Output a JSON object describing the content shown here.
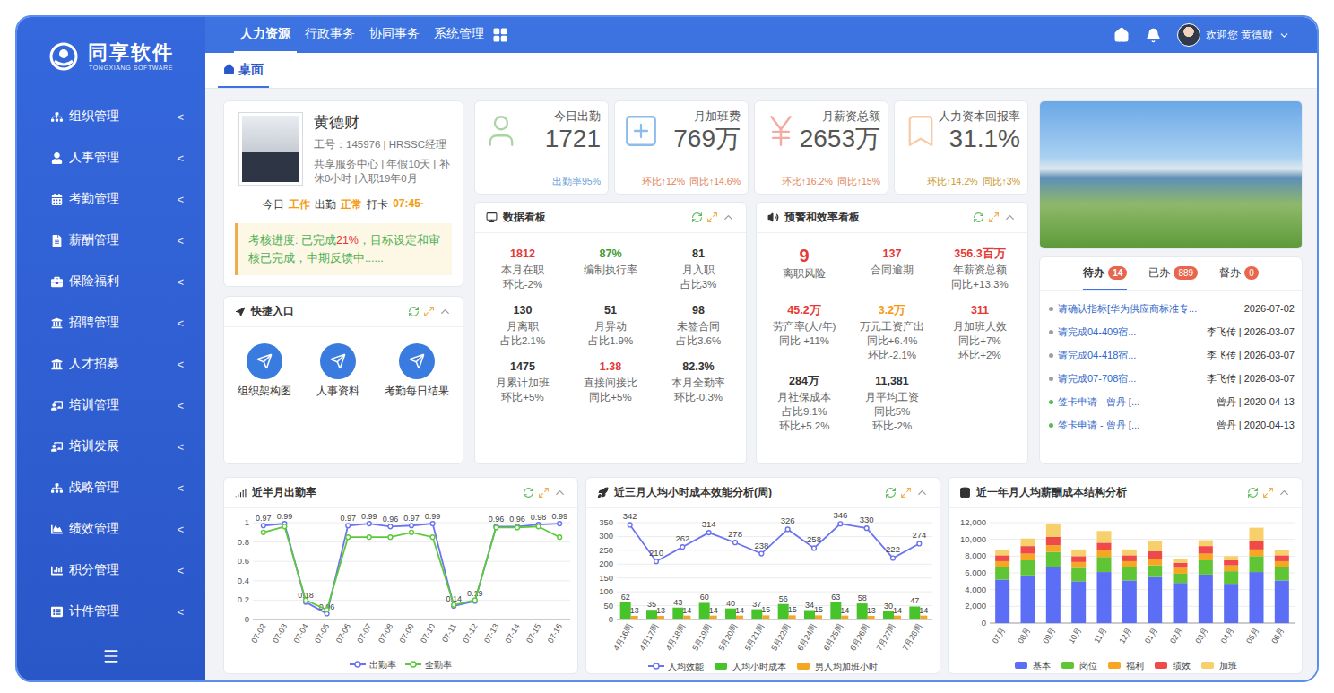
{
  "logo": {
    "name": "同享软件",
    "subtitle": "TONGXIANG SOFTWARE"
  },
  "top_nav": [
    {
      "label": "人力资源",
      "selected": true
    },
    {
      "label": "行政事务",
      "selected": false
    },
    {
      "label": "协同事务",
      "selected": false
    },
    {
      "label": "系统管理",
      "selected": false
    }
  ],
  "user": {
    "greeting": "欢迎您 黄德财"
  },
  "sidebar": {
    "chevron": "<",
    "items": [
      "组织管理",
      "人事管理",
      "考勤管理",
      "薪酬管理",
      "保险福利",
      "招聘管理",
      "人才招募",
      "培训管理",
      "培训发展",
      "战略管理",
      "绩效管理",
      "积分管理",
      "计件管理"
    ]
  },
  "tabs": [
    {
      "label": "桌面",
      "selected": true
    }
  ],
  "profile": {
    "name": "黄德财",
    "id_line": "工号：145976 | HRSSC经理",
    "info": "共享服务中心 | 年假10天 | 补休0小时 |入职19年0月",
    "today": [
      {
        "text": "今日",
        "highlight": false
      },
      {
        "text": "工作",
        "highlight": true
      },
      {
        "text": "出勤",
        "highlight": false
      },
      {
        "text": "正常",
        "highlight": true
      },
      {
        "text": "打卡",
        "highlight": false
      },
      {
        "text": "07:45-",
        "highlight": true
      }
    ]
  },
  "assessment": {
    "parts": [
      {
        "text": "考核进度: 已完成",
        "color": "#4caf50"
      },
      {
        "text": "21%",
        "color": "#e53935"
      },
      {
        "text": "，目标设定和审核已完成，中期反馈中......",
        "color": "#4caf50"
      }
    ]
  },
  "quick_entry": {
    "title": "快捷入口",
    "items": [
      "组织架构图",
      "人事资料",
      "考勤每日结果"
    ]
  },
  "kpis": [
    {
      "title": "今日出勤",
      "value": "1721",
      "notes": [
        "出勤率95%"
      ],
      "color": "#a8d5a2",
      "note_color": "#6fa1d6"
    },
    {
      "title": "月加班费",
      "value": "769万",
      "notes": [
        "环比↑12%",
        "同比↑14.6%"
      ],
      "color": "#8cbcea",
      "note_color": "#e0845a"
    },
    {
      "title": "月薪资总额",
      "value": "2653万",
      "notes": [
        "环比↑16.2%",
        "同比↑15%"
      ],
      "color": "#f4aba1",
      "note_color": "#e0845a"
    },
    {
      "title": "人力资本回报率",
      "value": "31.1%",
      "notes": [
        "环比↑14.2%",
        "同比↑3%"
      ],
      "color": "#f8cba6",
      "note_color": "#c9962c"
    }
  ],
  "data_board": {
    "title": "数据看板",
    "cells": [
      {
        "value": "1812",
        "label": "本月在职",
        "notes": [
          "环比-2%"
        ],
        "color": "#e53935",
        "kind": "normal"
      },
      {
        "value": "87%",
        "label": "编制执行率",
        "notes": [],
        "color": "#3c9a3c",
        "kind": "normal"
      },
      {
        "value": "81",
        "label": "月入职",
        "notes": [
          "占比3%"
        ],
        "color": "#333333",
        "kind": "normal"
      },
      {
        "value": "130",
        "label": "月离职",
        "notes": [
          "占比2.1%"
        ],
        "color": "#333333",
        "kind": "normal"
      },
      {
        "value": "51",
        "label": "月异动",
        "notes": [
          "占比1.9%"
        ],
        "color": "#333333",
        "kind": "normal"
      },
      {
        "value": "98",
        "label": "未签合同",
        "notes": [
          "占比3.6%"
        ],
        "color": "#333333",
        "kind": "normal"
      },
      {
        "value": "1475",
        "label": "月累计加班",
        "notes": [
          "环比+5%"
        ],
        "color": "#333333",
        "kind": "normal"
      },
      {
        "value": "1.38",
        "label": "直接间接比",
        "notes": [
          "同比+5%"
        ],
        "color": "#e53935",
        "kind": "normal"
      },
      {
        "value": "82.3%",
        "label": "本月全勤率",
        "notes": [
          "环比-0.3%"
        ],
        "color": "#333333",
        "kind": "normal"
      }
    ]
  },
  "warning_board": {
    "title": "预警和效率看板",
    "cells": [
      {
        "value": "9",
        "label": "离职风险",
        "notes": [],
        "color": "#e53935",
        "kind": "big"
      },
      {
        "value": "137",
        "label": "合同逾期",
        "notes": [],
        "color": "#e53935",
        "kind": "normal"
      },
      {
        "value": "356.3百万",
        "label": "年薪资总额",
        "notes": [
          "同比+13.3%"
        ],
        "color": "#e53935",
        "kind": "normal"
      },
      {
        "value": "45.2万",
        "label": "劳产率(人/年)",
        "notes": [
          "同比 +11%"
        ],
        "color": "#e53935",
        "kind": "normal"
      },
      {
        "value": "3.2万",
        "label": "万元工资产出",
        "notes": [
          "同比+6.4%",
          "环比-2.1%"
        ],
        "color": "#f39c12",
        "kind": "normal"
      },
      {
        "value": "311",
        "label": "月加班人效",
        "notes": [
          "同比+7%",
          "环比+2%"
        ],
        "color": "#e53935",
        "kind": "normal"
      },
      {
        "value": "284万",
        "label": "月社保成本",
        "notes": [
          "占比9.1%",
          "环比+5.2%"
        ],
        "color": "#333333",
        "kind": "normal"
      },
      {
        "value": "11,381",
        "label": "月平均工资",
        "notes": [
          "同比5%",
          "环比-2%"
        ],
        "color": "#333333",
        "kind": "normal"
      }
    ]
  },
  "todo": {
    "tabs": [
      {
        "label": "待办",
        "count": "14",
        "selected": true
      },
      {
        "label": "已办",
        "count": "889",
        "selected": false
      },
      {
        "label": "督办",
        "count": "0",
        "selected": false
      }
    ],
    "rows": [
      {
        "title": "请确认指标[华为供应商标准专...",
        "meta": "2026-07-02",
        "color": "#9aa0aa"
      },
      {
        "title": "请完成04-409宿...",
        "meta": "李飞传 | 2026-03-07",
        "color": "#9aa0aa"
      },
      {
        "title": "请完成04-418宿...",
        "meta": "李飞传 | 2026-03-07",
        "color": "#9aa0aa"
      },
      {
        "title": "请完成07-708宿...",
        "meta": "李飞传 | 2026-03-07",
        "color": "#9aa0aa"
      },
      {
        "title": "签卡申请 - 曾丹 [...",
        "meta": "曾丹 | 2020-04-13",
        "color": "#5cb85c"
      },
      {
        "title": "签卡申请 - 曾丹 [...",
        "meta": "曾丹 | 2020-04-13",
        "color": "#5cb85c"
      }
    ]
  },
  "charts": {
    "attendance": {
      "title": "近半月出勤率",
      "y_ticks": [
        "0",
        "0.2",
        "0.4",
        "0.6",
        "0.8",
        "1"
      ],
      "x_labels": [
        "07-02",
        "07-03",
        "07-04",
        "07-05",
        "07-06",
        "07-07",
        "07-08",
        "07-09",
        "07-10",
        "07-11",
        "07-12",
        "07-13",
        "07-14",
        "07-15",
        "07-16"
      ],
      "series": [
        {
          "name": "出勤率",
          "kind": "line",
          "color": "#6b73f0",
          "show_values": true,
          "values": [
            0.97,
            0.99,
            0.18,
            0.06,
            0.97,
            0.99,
            0.96,
            0.97,
            0.99,
            0.14,
            0.19,
            0.96,
            0.96,
            0.98,
            0.99
          ]
        },
        {
          "name": "全勤率",
          "kind": "line",
          "color": "#5cc93b",
          "show_values": false,
          "values": [
            0.9,
            0.96,
            0.2,
            0.1,
            0.85,
            0.85,
            0.85,
            0.9,
            0.85,
            0.15,
            0.2,
            0.95,
            0.95,
            0.96,
            0.85
          ]
        }
      ]
    },
    "efficiency": {
      "title": "近三月人均小时成本效能分析(周)",
      "y_ticks": [
        "0",
        "50",
        "100",
        "150",
        "200",
        "250",
        "300",
        "350"
      ],
      "x_labels": [
        "4月16周",
        "4月17周",
        "4月18周",
        "5月19周",
        "5月20周",
        "5月21周",
        "5月22周",
        "6月24周",
        "6月25周",
        "6月26周",
        "7月27周",
        "7月28周"
      ],
      "series": [
        {
          "name": "人均效能",
          "kind": "line",
          "color": "#6b73f0",
          "values": [
            342,
            210,
            262,
            314,
            278,
            238,
            326,
            258,
            346,
            330,
            222,
            274
          ]
        },
        {
          "name": "人均小时成本",
          "kind": "bar",
          "color": "#47c42a",
          "values": [
            62,
            35,
            43,
            60,
            40,
            37,
            56,
            34,
            63,
            58,
            30,
            47
          ]
        },
        {
          "name": "男人均加班小时",
          "kind": "bar",
          "color": "#f5a623",
          "values": [
            13,
            13,
            14,
            14,
            14,
            15,
            15,
            15,
            14,
            13,
            14,
            14
          ]
        }
      ]
    },
    "salary": {
      "title": "近一年月人均薪酬成本结构分析",
      "y_ticks": [
        "0",
        "2,000",
        "4,000",
        "6,000",
        "8,000",
        "10,000",
        "12,000"
      ],
      "x_labels": [
        "07月",
        "08月",
        "09月",
        "10月",
        "11月",
        "12月",
        "01月",
        "02月",
        "03月",
        "04月",
        "05月",
        "06月"
      ],
      "series": [
        {
          "name": "基本",
          "kind": "bar",
          "color": "#5b6ef5",
          "values": [
            5200,
            5700,
            6700,
            5000,
            6100,
            5100,
            5500,
            4800,
            5800,
            4700,
            6100,
            5100
          ]
        },
        {
          "name": "岗位",
          "kind": "bar",
          "color": "#5fc535",
          "values": [
            1500,
            1800,
            1800,
            1600,
            1800,
            1600,
            1400,
            1100,
            1700,
            1500,
            1900,
            1600
          ]
        },
        {
          "name": "福利",
          "kind": "bar",
          "color": "#f6a623",
          "values": [
            700,
            800,
            800,
            700,
            800,
            700,
            800,
            700,
            800,
            700,
            800,
            700
          ]
        },
        {
          "name": "绩效",
          "kind": "bar",
          "color": "#ee4a4a",
          "values": [
            700,
            900,
            1000,
            700,
            900,
            700,
            900,
            600,
            900,
            600,
            1000,
            700
          ]
        },
        {
          "name": "加班",
          "kind": "bar",
          "color": "#f7cf6b",
          "values": [
            600,
            900,
            1600,
            800,
            1400,
            700,
            1200,
            500,
            700,
            500,
            1600,
            600
          ]
        }
      ]
    }
  }
}
